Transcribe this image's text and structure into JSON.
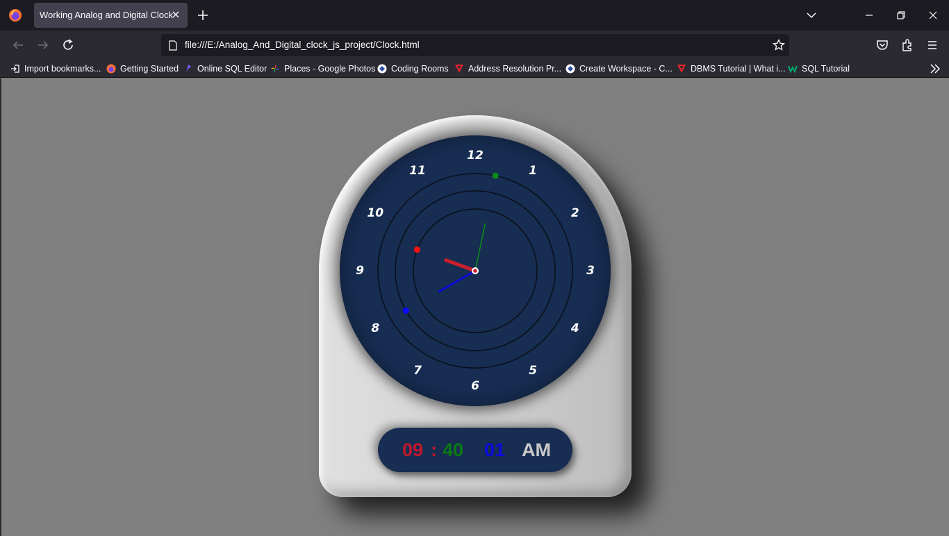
{
  "browser": {
    "tab_title": "Working Analog and Digital Clock",
    "url": "file:///E:/Analog_And_Digital_clock_js_project/Clock.html",
    "bookmarks": [
      {
        "label": "Import bookmarks...",
        "icon": "import-icon"
      },
      {
        "label": "Getting Started",
        "icon": "firefox-icon"
      },
      {
        "label": "Online SQL Editor",
        "icon": "sql-editor-icon"
      },
      {
        "label": "Places - Google Photos",
        "icon": "google-photos-icon"
      },
      {
        "label": "Coding Rooms",
        "icon": "coding-rooms-icon"
      },
      {
        "label": "Address Resolution Pr...",
        "icon": "red-triangle-icon"
      },
      {
        "label": "Create Workspace - C...",
        "icon": "coding-rooms-icon"
      },
      {
        "label": "DBMS Tutorial | What i...",
        "icon": "red-triangle-icon"
      },
      {
        "label": "SQL Tutorial",
        "icon": "w3schools-icon"
      }
    ]
  },
  "clock": {
    "numerals": [
      "12",
      "1",
      "2",
      "3",
      "4",
      "5",
      "6",
      "7",
      "8",
      "9",
      "10",
      "11"
    ],
    "hand_colors": {
      "hour": "#cc1f2e",
      "minute": "#0b0bd6",
      "second": "#0a8a1a"
    },
    "dial_color": "#172d52",
    "digital": {
      "hours": "09",
      "separator": ":",
      "minutes": "40",
      "seconds": "01",
      "ampm": "AM"
    },
    "digit_colors": {
      "hours": "#c0182c",
      "minutes": "#0a7a12",
      "seconds": "#0a0adf",
      "ampm": "#c8c8c8"
    }
  }
}
